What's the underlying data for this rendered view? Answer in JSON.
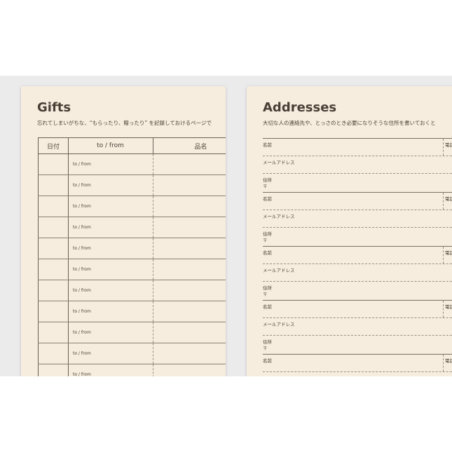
{
  "gifts": {
    "title": "Gifts",
    "subtitle": "忘れてしまいがちな、“もらったり、贈ったり” を記録しておけるページで",
    "headers": {
      "date": "日付",
      "tofrom": "to / from",
      "item": "品名"
    },
    "rows": [
      "to / from",
      "to / from",
      "to / from",
      "to / from",
      "to / from",
      "to / from",
      "to / from",
      "to / from",
      "to / from",
      "to / from",
      "to / from"
    ]
  },
  "addresses": {
    "title": "Addresses",
    "subtitle": "大切な人の連絡先や、とっさのとき必要になりそうな住所を書いておくと",
    "labels": {
      "name": "名前",
      "phone": "電話",
      "email": "メールアドレス",
      "address": "住所",
      "zip": "〒"
    },
    "block_count": 5
  }
}
